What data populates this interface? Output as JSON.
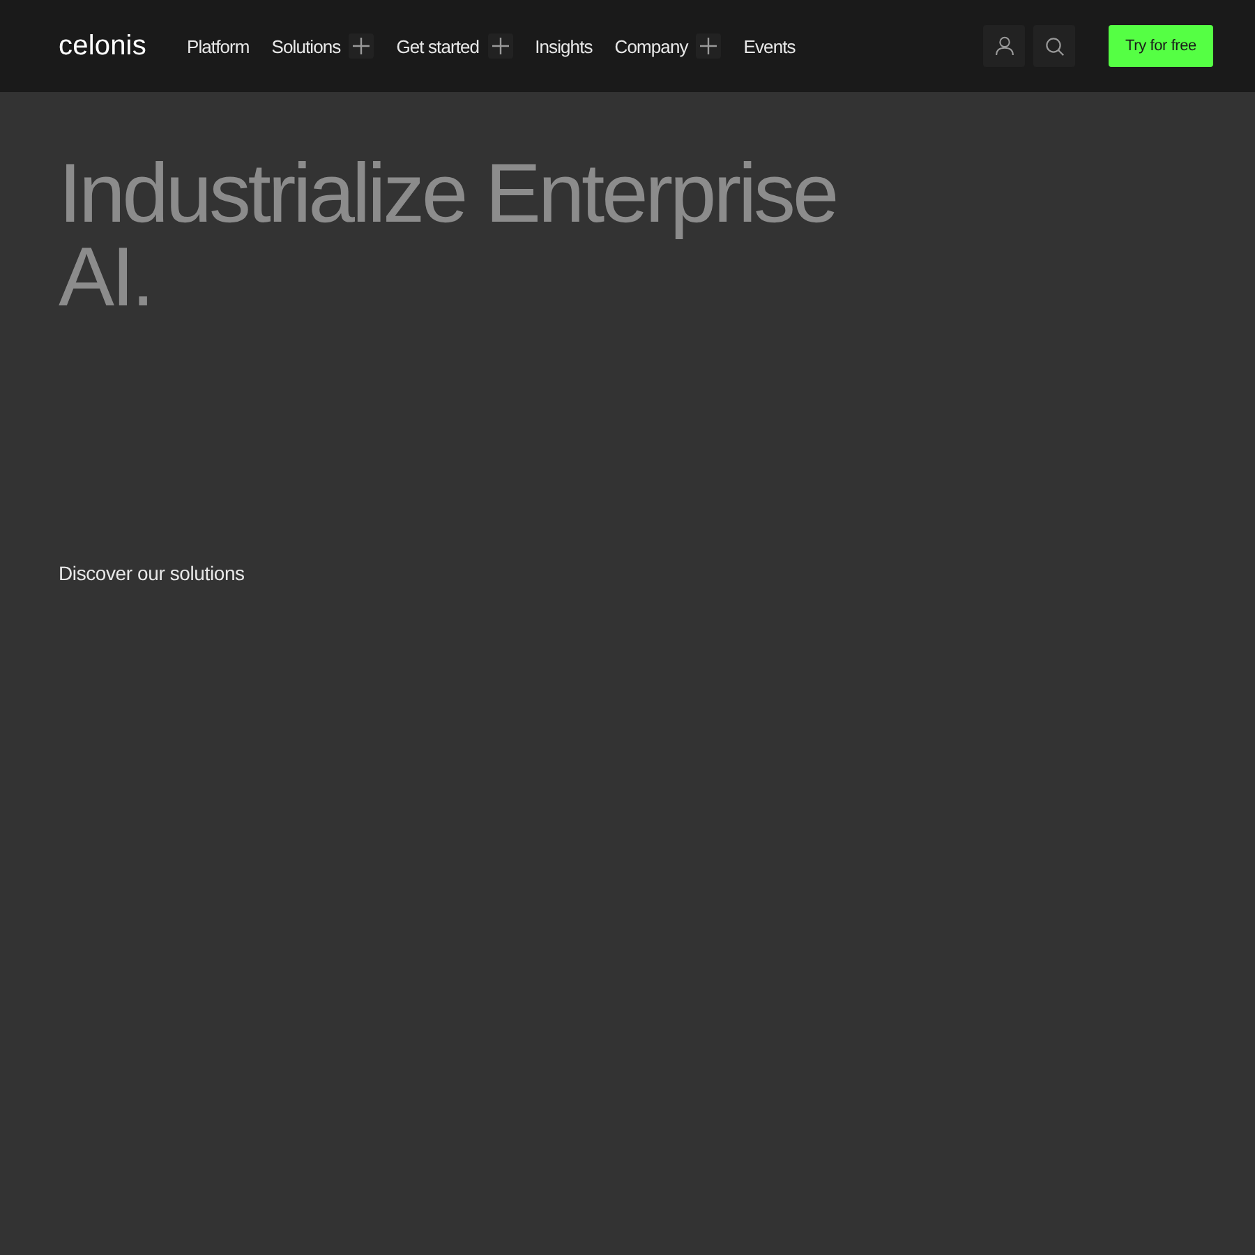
{
  "header": {
    "logo": "celonis",
    "nav_items": [
      {
        "label": "Platform",
        "has_submenu": false
      },
      {
        "label": "Solutions",
        "has_submenu": true
      },
      {
        "label": "Get started",
        "has_submenu": true
      },
      {
        "label": "Insights",
        "has_submenu": false
      },
      {
        "label": "Company",
        "has_submenu": true
      },
      {
        "label": "Events",
        "has_submenu": false
      }
    ],
    "cta": "Try for free"
  },
  "hero": {
    "title": "Industrialize Enterprise AI.",
    "link": "Discover our solutions"
  }
}
